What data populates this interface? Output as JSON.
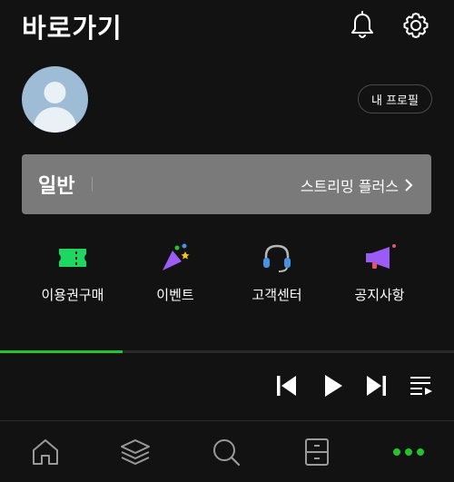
{
  "header": {
    "title": "바로가기",
    "bell_icon": "bell-icon",
    "settings_icon": "gear-icon"
  },
  "profile": {
    "button_label": "내 프로필",
    "avatar_icon": "default-avatar-icon"
  },
  "membership": {
    "tier": "일반",
    "upsell_label": "스트리밍 플러스",
    "upsell_arrow": "chevron-right-icon",
    "bg_color": "#7a7a7a"
  },
  "quick_links": [
    {
      "label": "이용권구매",
      "icon": "ticket-icon",
      "color": "#1ed760"
    },
    {
      "label": "이벤트",
      "icon": "party-popper-icon",
      "color": "#9b5cf6"
    },
    {
      "label": "고객센터",
      "icon": "headset-icon",
      "color": "#4a90e2"
    },
    {
      "label": "공지사항",
      "icon": "megaphone-icon",
      "color": "#9b5cf6"
    }
  ],
  "player": {
    "progress_fraction": 0.27,
    "accent_color": "#22c32e",
    "controls": [
      "previous-icon",
      "play-icon",
      "next-icon",
      "queue-icon"
    ]
  },
  "bottom_nav": [
    {
      "icon": "home-icon"
    },
    {
      "icon": "layers-icon"
    },
    {
      "icon": "search-icon"
    },
    {
      "icon": "locker-icon"
    },
    {
      "icon": "more-dots-icon",
      "active_color": "#22c32e"
    }
  ]
}
